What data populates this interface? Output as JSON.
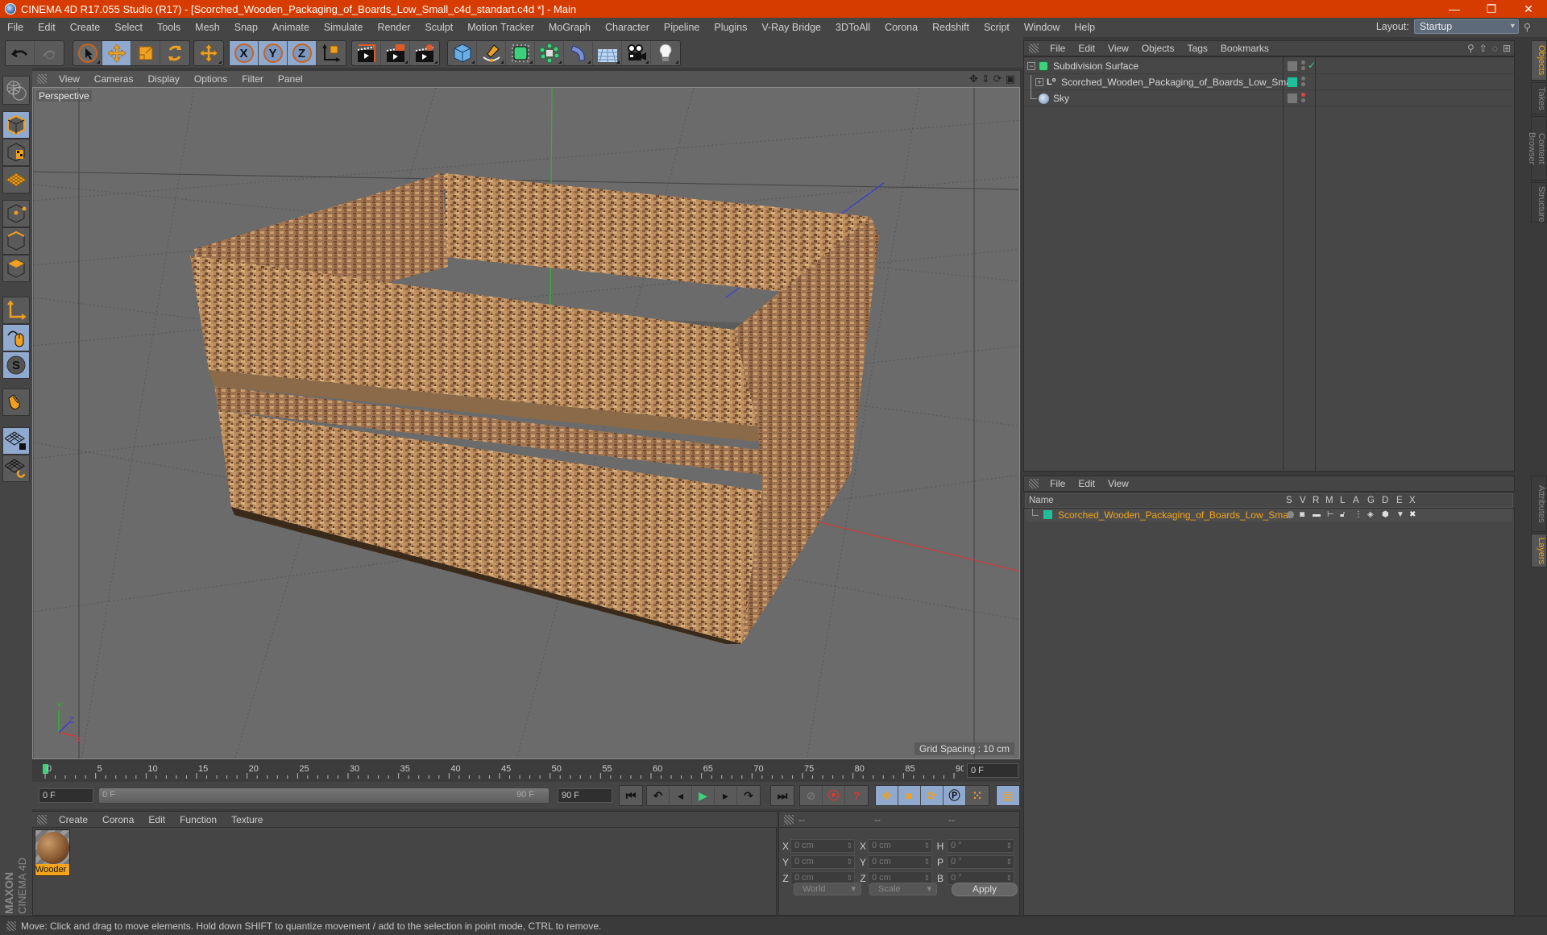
{
  "window": {
    "title": "CINEMA 4D R17.055 Studio (R17) - [Scorched_Wooden_Packaging_of_Boards_Low_Small_c4d_standart.c4d *] - Main",
    "controls": [
      "minimize",
      "restore",
      "close"
    ]
  },
  "menubar": {
    "items": [
      "File",
      "Edit",
      "Create",
      "Select",
      "Tools",
      "Mesh",
      "Snap",
      "Animate",
      "Simulate",
      "Render",
      "Sculpt",
      "Motion Tracker",
      "MoGraph",
      "Character",
      "Pipeline",
      "Plugins",
      "V-Ray Bridge",
      "3DToAll",
      "Corona",
      "Redshift",
      "Script",
      "Window",
      "Help"
    ],
    "layout_label": "Layout:",
    "layout_value": "Startup"
  },
  "toolbar": {
    "groups": [
      {
        "name": "history",
        "buttons": [
          "undo-icon",
          "redo-icon"
        ]
      },
      {
        "name": "tools",
        "buttons": [
          "live-selection-icon",
          "move-icon",
          "scale-icon",
          "rotate-icon"
        ]
      },
      {
        "name": "recent",
        "buttons": [
          "move-recent-icon"
        ]
      },
      {
        "name": "axis",
        "buttons": [
          "x-axis-icon",
          "y-axis-icon",
          "z-axis-icon",
          "world-coordinate-icon"
        ]
      },
      {
        "name": "render",
        "buttons": [
          "render-view-icon",
          "render-picture-viewer-icon",
          "render-settings-icon"
        ]
      },
      {
        "name": "objects",
        "buttons": [
          "cube-icon",
          "pen-spline-icon",
          "subdivision-icon",
          "cloner-icon",
          "deformer-icon",
          "floor-icon",
          "camera-icon",
          "light-icon"
        ]
      }
    ],
    "axis_labels": [
      "X",
      "Y",
      "Z"
    ]
  },
  "leftbar": {
    "tools": [
      "make-editable-icon",
      "model-mode-icon",
      "texture-mode-icon",
      "workplane-icon",
      "points-mode-icon",
      "edges-mode-icon",
      "polygons-mode-icon",
      "axis-mode-icon",
      "tweak-mode-icon",
      "solo-icon",
      "snap-icon",
      "locked-workplane-icon",
      "planar-workplane-icon"
    ]
  },
  "viewport": {
    "menu": [
      "View",
      "Cameras",
      "Display",
      "Options",
      "Filter",
      "Panel"
    ],
    "camera_label": "Perspective",
    "grid_spacing": "Grid Spacing : 10 cm",
    "nav_icons": [
      "pan-icon",
      "dolly-icon",
      "orbit-icon",
      "maximize-icon"
    ],
    "axis_gizmo": {
      "x": "X",
      "y": "Y",
      "z": "Z"
    }
  },
  "timeline": {
    "ticks": [
      "0",
      "5",
      "10",
      "15",
      "20",
      "25",
      "30",
      "35",
      "40",
      "45",
      "50",
      "55",
      "60",
      "65",
      "70",
      "75",
      "80",
      "85",
      "90"
    ],
    "current_frame": "0 F",
    "start_field": "0 F",
    "range_start": "0 F",
    "range_end": "90 F",
    "end_field": "90 F",
    "playhead_fraction": 0
  },
  "transport": {
    "buttons": [
      "go-to-start-icon",
      "previous-key-icon",
      "previous-frame-icon",
      "play-icon",
      "next-frame-icon",
      "next-key-icon",
      "go-to-end-icon",
      "record-disabled-icon",
      "autokey-icon",
      "keyframe-help-icon",
      "key-position-icon",
      "key-scale-icon",
      "key-rotation-icon",
      "key-param-icon",
      "key-pla-icon",
      "timeline-icon"
    ]
  },
  "material_manager": {
    "menu": [
      "Create",
      "Corona",
      "Edit",
      "Function",
      "Texture"
    ],
    "materials": [
      {
        "name": "Wooden",
        "label_shown": "Wooder"
      }
    ]
  },
  "coordinates": {
    "headers": [
      "--",
      "--",
      "--"
    ],
    "rows": [
      {
        "l1": "X",
        "v1": "0 cm",
        "l2": "X",
        "v2": "0 cm",
        "l3": "H",
        "v3": "0 °"
      },
      {
        "l1": "Y",
        "v1": "0 cm",
        "l2": "Y",
        "v2": "0 cm",
        "l3": "P",
        "v3": "0 °"
      },
      {
        "l1": "Z",
        "v1": "0 cm",
        "l2": "Z",
        "v2": "0 cm",
        "l3": "B",
        "v3": "0 °"
      }
    ],
    "space_dropdown": "World",
    "mode_dropdown": "Scale",
    "apply_label": "Apply"
  },
  "object_manager": {
    "menu": [
      "File",
      "Edit",
      "View",
      "Objects",
      "Tags",
      "Bookmarks"
    ],
    "objects": [
      {
        "name": "Subdivision Surface",
        "icon": "subdivision-icon",
        "indent": 0,
        "expander": "−",
        "check": "✓"
      },
      {
        "name": "Scorched_Wooden_Packaging_of_Boards_Low_Small",
        "icon": "null-object-icon",
        "indent": 1,
        "expander": "+",
        "tag_color": "#1fbf9a"
      },
      {
        "name": "Sky",
        "icon": "sky-icon",
        "indent": 0,
        "dot_color": "#e04545"
      }
    ]
  },
  "layer_manager": {
    "menu": [
      "File",
      "Edit",
      "View"
    ],
    "columns": [
      "Name",
      "S",
      "V",
      "R",
      "M",
      "L",
      "A",
      "G",
      "D",
      "E",
      "X"
    ],
    "layers": [
      {
        "name": "Scorched_Wooden_Packaging_of_Boards_Low_Small",
        "color": "#1fbf9a"
      }
    ]
  },
  "right_tabs": {
    "top": [
      {
        "label": "Objects",
        "active": true
      },
      {
        "label": "Takes"
      },
      {
        "label": "Content Browser"
      },
      {
        "label": "Structure"
      }
    ],
    "bottom": [
      {
        "label": "Attributes"
      },
      {
        "label": "Layers",
        "active": true
      }
    ]
  },
  "branding": {
    "maxon": "MAXON",
    "product": "CINEMA 4D"
  },
  "status": "Move: Click and drag to move elements. Hold down SHIFT to quantize movement / add to the selection in point mode, CTRL to remove.",
  "colors": {
    "titlebar": "#d63b00",
    "accent": "#f3a51b",
    "active_tool": "#8fa9cf",
    "axis_x": "#d23a3a",
    "axis_y": "#2fb52f",
    "axis_z": "#3a3ad8"
  }
}
